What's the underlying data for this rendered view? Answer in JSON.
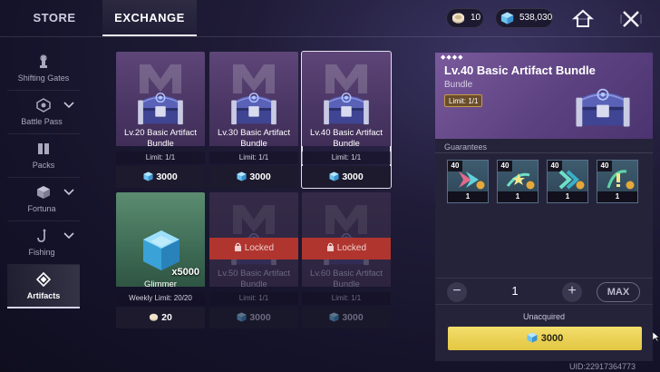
{
  "topbar": {
    "tabs": [
      {
        "label": "STORE"
      },
      {
        "label": "EXCHANGE"
      }
    ],
    "currencies": {
      "coin": "10",
      "gem": "538,030"
    },
    "home_icon": "home-icon",
    "close_icon": "close-icon"
  },
  "sidebar": {
    "items": [
      {
        "label": "Shifting Gates",
        "icon": "tower-icon"
      },
      {
        "label": "Battle Pass",
        "icon": "emblem-icon"
      },
      {
        "label": "Packs",
        "icon": "book-icon"
      },
      {
        "label": "Fortuna",
        "icon": "cube-icon"
      },
      {
        "label": "Fishing",
        "icon": "hook-icon"
      },
      {
        "label": "Artifacts",
        "icon": "artifact-icon"
      }
    ]
  },
  "items": [
    {
      "name": "Lv.20 Basic Artifact Bundle",
      "limit": "Limit: 1/1",
      "price": "3000"
    },
    {
      "name": "Lv.30 Basic Artifact Bundle",
      "limit": "Limit: 1/1",
      "price": "3000"
    },
    {
      "name": "Lv.40 Basic Artifact Bundle",
      "limit": "Limit: 1/1",
      "price": "3000"
    },
    {
      "name": "Glimmer",
      "quantity": "x5000",
      "limit": "Weekly Limit: 20/20",
      "price": "20"
    },
    {
      "name": "Lv.50 Basic Artifact Bundle",
      "limit": "Limit: 1/1",
      "price": "3000",
      "status": "Locked"
    },
    {
      "name": "Lv.60 Basic Artifact Bundle",
      "limit": "Limit: 1/1",
      "price": "3000",
      "status": "Locked"
    }
  ],
  "detail": {
    "title": "Lv.40 Basic Artifact Bundle",
    "type": "Bundle",
    "limit": "Limit: 1/1",
    "guarantees_label": "Guarantees",
    "guarantees": [
      {
        "level": "40",
        "qty": "1"
      },
      {
        "level": "40",
        "qty": "1"
      },
      {
        "level": "40",
        "qty": "1"
      },
      {
        "level": "40",
        "qty": "1"
      }
    ],
    "quantity": "1",
    "max_label": "MAX",
    "status": "Unacquired",
    "price": "3000"
  },
  "uid": "UID:22917364773",
  "colors": {
    "accent_gold": "#e9cf4f",
    "locked_red": "#b0352e",
    "card_purple": "#4a3664",
    "panel_bg": "#25233a"
  }
}
